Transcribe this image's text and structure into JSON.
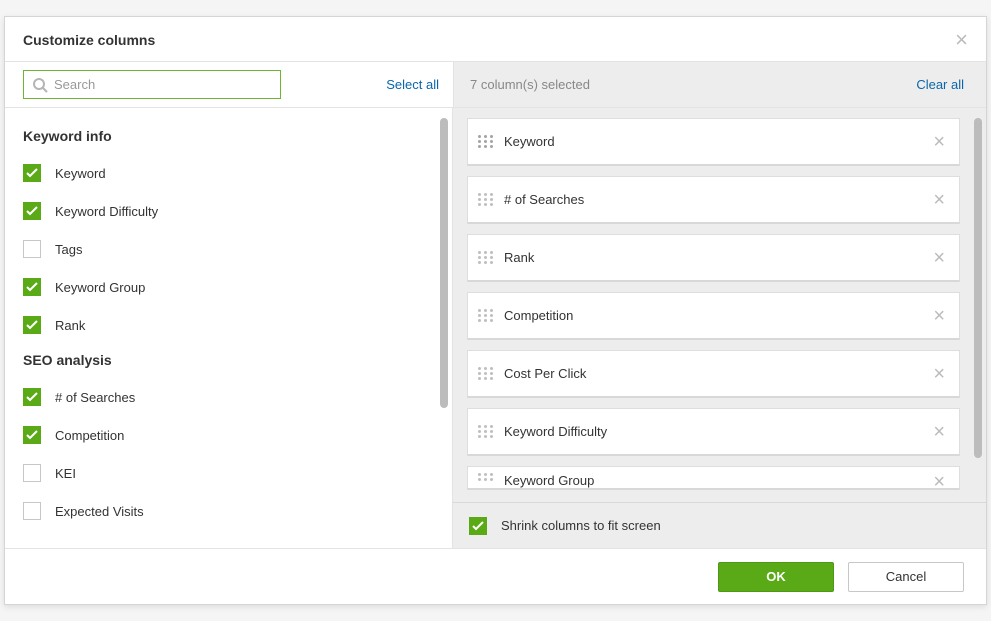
{
  "dialog": {
    "title": "Customize columns"
  },
  "search": {
    "placeholder": "Search"
  },
  "actions": {
    "select_all": "Select all",
    "clear_all": "Clear all"
  },
  "selected_summary": "7 column(s) selected",
  "groups": [
    {
      "title": "Keyword info",
      "items": [
        {
          "label": "Keyword",
          "checked": true
        },
        {
          "label": "Keyword Difficulty",
          "checked": true
        },
        {
          "label": "Tags",
          "checked": false
        },
        {
          "label": "Keyword Group",
          "checked": true
        },
        {
          "label": "Rank",
          "checked": true
        }
      ]
    },
    {
      "title": "SEO analysis",
      "items": [
        {
          "label": "# of Searches",
          "checked": true
        },
        {
          "label": "Competition",
          "checked": true
        },
        {
          "label": "KEI",
          "checked": false
        },
        {
          "label": "Expected Visits",
          "checked": false
        }
      ]
    }
  ],
  "selected_columns": [
    {
      "label": "Keyword",
      "locked": true
    },
    {
      "label": "# of Searches",
      "locked": false
    },
    {
      "label": "Rank",
      "locked": false
    },
    {
      "label": "Competition",
      "locked": false
    },
    {
      "label": "Cost Per Click",
      "locked": false
    },
    {
      "label": "Keyword Difficulty",
      "locked": false
    },
    {
      "label": "Keyword Group",
      "locked": false
    }
  ],
  "shrink": {
    "label": "Shrink columns to fit screen",
    "checked": true
  },
  "footer": {
    "ok": "OK",
    "cancel": "Cancel"
  }
}
